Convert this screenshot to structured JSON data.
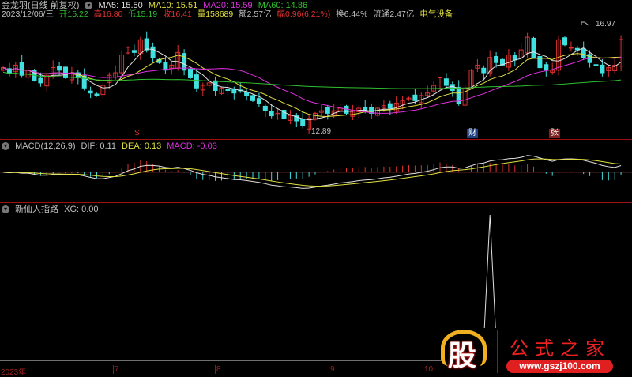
{
  "header": {
    "title": "金龙羽(日线 前复权)",
    "ma5": "MA5: 15.50",
    "ma10": "MA10: 15.51",
    "ma20": "MA20: 15.59",
    "ma60": "MA60: 14.86",
    "date": "2023/12/06/三",
    "open": "开15.22",
    "high": "高16.80",
    "low": "低15.19",
    "close": "收16.41",
    "volume": "量158689",
    "amount": "额2.57亿",
    "change": "幅0.96(6.21%)",
    "turnover": "换6.44%",
    "float": "流通2.47亿",
    "sector": "电气设备"
  },
  "main": {
    "high_label": "16.97",
    "low_label": "12.89",
    "marker_s": "S",
    "marker_cai": "财",
    "marker_zhang": "张"
  },
  "macd": {
    "title": "MACD(12,26,9)",
    "dif": "DIF: 0.11",
    "dea": "DEA: 0.13",
    "macd": "MACD: -0.03"
  },
  "xg": {
    "title": "新仙人指路",
    "value": "XG: 0.00",
    "signal_index": 78
  },
  "axis": {
    "labels": [
      "2023年",
      "7",
      "8",
      "9",
      "10"
    ]
  },
  "logo": {
    "char": "股",
    "name": "公式之家",
    "url": "www.gszj100.com"
  },
  "colors": {
    "up": "#e03030",
    "down": "#40e0e0",
    "ma5": "#e0e0e0",
    "ma10": "#e0e040",
    "ma20": "#e030e0",
    "ma60": "#30c030"
  },
  "chart_data": {
    "type": "candlestick",
    "closes": [
      15.3,
      15.1,
      15.4,
      15.0,
      15.2,
      14.8,
      14.7,
      15.0,
      15.3,
      15.2,
      14.9,
      15.1,
      14.9,
      14.5,
      14.3,
      14.2,
      14.6,
      15.0,
      15.1,
      15.8,
      16.1,
      15.9,
      16.4,
      16.0,
      15.7,
      15.5,
      15.2,
      15.4,
      15.9,
      15.2,
      14.9,
      14.5,
      14.6,
      14.7,
      14.4,
      14.5,
      14.4,
      14.3,
      14.4,
      14.2,
      14.0,
      13.9,
      13.6,
      13.4,
      13.5,
      13.3,
      13.4,
      13.2,
      13.0,
      13.3,
      13.5,
      13.6,
      13.5,
      13.6,
      13.7,
      13.5,
      13.6,
      13.7,
      13.6,
      13.5,
      13.7,
      13.8,
      13.7,
      13.9,
      14.0,
      14.1,
      14.0,
      14.2,
      14.3,
      14.6,
      14.9,
      14.6,
      14.4,
      13.9,
      14.5,
      15.2,
      15.4,
      15.1,
      15.7,
      15.5,
      15.4,
      15.8,
      15.6,
      16.0,
      16.5,
      15.7,
      15.3,
      15.2,
      15.2,
      16.4,
      16.2,
      16.1,
      16.0,
      15.7,
      15.5,
      15.4,
      15.1,
      15.3,
      15.4,
      16.41
    ],
    "price_range": [
      12.6,
      17.2
    ]
  }
}
